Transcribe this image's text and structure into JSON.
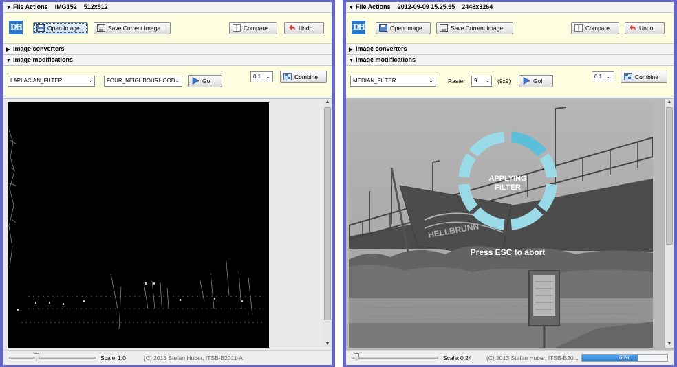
{
  "left": {
    "file_actions": {
      "title": "File Actions",
      "image_name": "IMG152",
      "dimensions": "512x512"
    },
    "toolbar": {
      "logo_text": "DH",
      "open": "Open Image",
      "save": "Save Current Image",
      "compare": "Compare",
      "undo": "Undo"
    },
    "converters": {
      "title": "Image converters"
    },
    "modifications": {
      "title": "Image modifications",
      "filter": "LAPLACIAN_FILTER",
      "variant": "FOUR_NEIGHBOURHOOD",
      "go": "Go!",
      "alpha": "0.1",
      "combine": "Combine"
    },
    "status": {
      "scale_label": "Scale:",
      "scale_value": "1.0",
      "copyright": "(C) 2013 Stefan Huber, ITSB-B2011-A"
    }
  },
  "right": {
    "file_actions": {
      "title": "File Actions",
      "image_name": "2012-09-09 15.25.55",
      "dimensions": "2448x3264"
    },
    "toolbar": {
      "logo_text": "DH",
      "open": "Open Image",
      "save": "Save Current Image",
      "compare": "Compare",
      "undo": "Undo"
    },
    "converters": {
      "title": "Image converters"
    },
    "modifications": {
      "title": "Image modifications",
      "filter": "MEDIAN_FILTER",
      "raster_label": "Raster:",
      "raster_value": "9",
      "raster_size": "(9x9)",
      "go": "Go!",
      "alpha": "0.1",
      "combine": "Combine"
    },
    "overlay": {
      "line1": "APPLYING",
      "line2": "FILTER",
      "abort": "Press ESC to abort",
      "boat_text": "HELLBRUNN"
    },
    "status": {
      "scale_label": "Scale:",
      "scale_value": "0.24",
      "copyright": "(C) 2013 Stefan Huber, ITSB-B20...",
      "progress_text": "65%",
      "progress_value": 0.65
    }
  },
  "colors": {
    "frame": "#6366c4",
    "panel_yellow": "#fdfde0",
    "spinner": "#9ad9e6",
    "spinner_active": "#5bbfd9",
    "progress": "#2e7fd0"
  }
}
